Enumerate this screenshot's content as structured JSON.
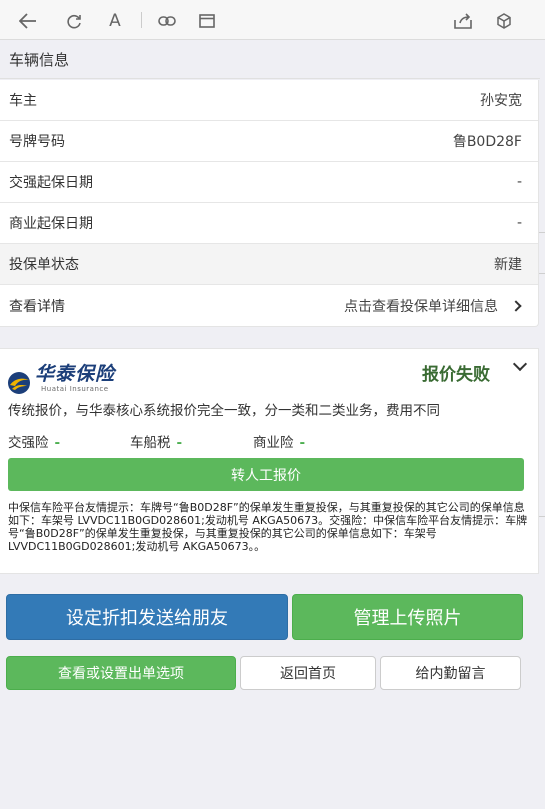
{
  "toolbar": {
    "icons": [
      "back-icon",
      "refresh-icon",
      "font-size-icon",
      "link-icon",
      "window-icon",
      "share-icon",
      "cube-icon"
    ],
    "font_glyph": "A"
  },
  "vehicle_section": {
    "title": "车辆信息",
    "rows": [
      {
        "label": "车主",
        "value": "孙安宽"
      },
      {
        "label": "号牌号码",
        "value": "鲁B0D28F"
      },
      {
        "label": "交强起保日期",
        "value": "-"
      },
      {
        "label": "商业起保日期",
        "value": "-"
      },
      {
        "label": "投保单状态",
        "value": "新建"
      },
      {
        "label": "查看详情",
        "value": "点击查看投保单详细信息"
      }
    ]
  },
  "quote": {
    "insurer_name_cn": "华泰保险",
    "insurer_name_en": "Huatai Insurance",
    "status": "报价失败",
    "description": "传统报价，与华泰核心系统报价完全一致，分一类和二类业务，费用不同",
    "premiums": [
      {
        "label": "交强险",
        "value": "-"
      },
      {
        "label": "车船税",
        "value": "-"
      },
      {
        "label": "商业险",
        "value": "-"
      }
    ],
    "manual_button": "转人工报价",
    "notice": "中保信车险平台友情提示：车牌号“鲁B0D28F”的保单发生重复投保，与其重复投保的其它公司的保单信息如下：车架号 LVVDC11B0GD028601;发动机号 AKGA50673。交强险：中保信车险平台友情提示：车牌号“鲁B0D28F”的保单发生重复投保，与其重复投保的其它公司的保单信息如下：车架号 LVVDC11B0GD028601;发动机号 AKGA50673。。",
    "brand_colors": {
      "blue": "#1c3f7a",
      "gold": "#f0b400",
      "status_green": "#3a6b33"
    }
  },
  "actions": {
    "send_discount": "设定折扣发送给朋友",
    "upload_photos": "管理上传照片",
    "order_options": "查看或设置出单选项",
    "home": "返回首页",
    "message": "给内勤留言"
  },
  "colors": {
    "primary_blue": "#337ab7",
    "success_green": "#5cb85c",
    "background": "#efeff4"
  }
}
